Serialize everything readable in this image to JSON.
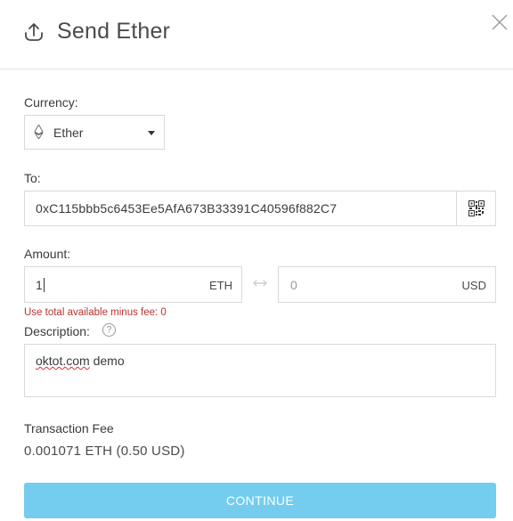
{
  "header": {
    "title": "Send Ether"
  },
  "icons": {
    "upload": "upload-icon",
    "close": "close-icon",
    "eth": "ethereum-icon",
    "caret": "caret-down-icon",
    "qr": "qr-code-icon",
    "swap": "swap-arrows-icon",
    "help": "help-icon"
  },
  "form": {
    "currency_label": "Currency:",
    "currency_value": "Ether",
    "to_label": "To:",
    "to_value": "0xC115bbb5c6453Ee5AfA673B33391C40596f882C7",
    "amount_label": "Amount:",
    "amount_value": "1",
    "amount_unit": "ETH",
    "usd_value": "0",
    "usd_unit": "USD",
    "fee_link": "Use total available minus fee: 0",
    "description_label": "Description:",
    "help_symbol": "?",
    "description_word1": "oktot.com",
    "description_word2": " demo"
  },
  "fee": {
    "title": "Transaction Fee",
    "value": "0.001071 ETH (0.50 USD)"
  },
  "actions": {
    "continue_label": "CONTINUE"
  },
  "colors": {
    "accent": "#74ccef",
    "error": "#b8322f",
    "border": "#d9d9d9"
  }
}
